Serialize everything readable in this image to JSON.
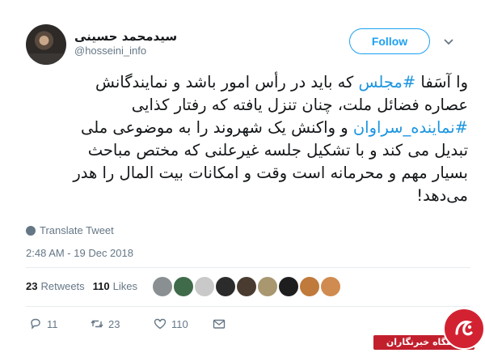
{
  "user": {
    "display_name": "سیدمحمد حسینی",
    "handle": "@hosseini_info"
  },
  "follow_label": "Follow",
  "tweet": {
    "lines": [
      [
        "وا آسَفا ",
        "#مجلس",
        " که باید در رأس امور باشد و نمایندگانش"
      ],
      [
        "عصاره فضائل ملت، چنان تنزل یافته که رفتار کذایی"
      ],
      [
        "#نماینده_سراوان",
        " و واکنش یک شهروند را به موضوعی ملی"
      ],
      [
        "تبدیل می کند و با تشکیل جلسه غیرعلنی که مختص مباحث"
      ],
      [
        "بسیار مهم و محرمانه است وقت و امکانات بیت المال را هدر"
      ],
      [
        "می‌دهد!"
      ]
    ]
  },
  "translate_label": "Translate Tweet",
  "timestamp": "2:48 AM - 19 Dec 2018",
  "stats": {
    "retweets_count": "23",
    "retweets_label": "Retweets",
    "likes_count": "110",
    "likes_label": "Likes"
  },
  "likers": [
    {
      "color": "#8a8f92"
    },
    {
      "color": "#3f6b4a"
    },
    {
      "color": "#c9c9c9"
    },
    {
      "color": "#2b2b2b"
    },
    {
      "color": "#4a3b30"
    },
    {
      "color": "#a8976f"
    },
    {
      "color": "#1e1e1e"
    },
    {
      "color": "#c07a3c"
    },
    {
      "color": "#d08b50"
    }
  ],
  "actions": {
    "reply_count": "11",
    "retweet_count": "23",
    "like_count": "110"
  },
  "watermark": {
    "text": "باشگاه خبرنگاران"
  }
}
